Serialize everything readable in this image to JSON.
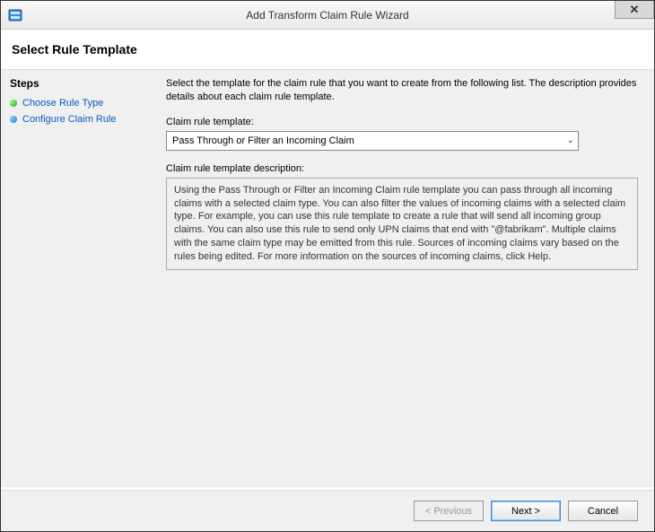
{
  "window": {
    "title": "Add Transform Claim Rule Wizard"
  },
  "header": {
    "subtitle": "Select Rule Template"
  },
  "sidebar": {
    "heading": "Steps",
    "items": [
      {
        "label": "Choose Rule Type"
      },
      {
        "label": "Configure Claim Rule"
      }
    ]
  },
  "content": {
    "intro": "Select the template for the claim rule that you want to create from the following list. The description provides details about each claim rule template.",
    "template_label": "Claim rule template:",
    "template_selected": "Pass Through or Filter an Incoming Claim",
    "description_label": "Claim rule template description:",
    "description_text": "Using the Pass Through or Filter an Incoming Claim rule template you can pass through all incoming claims with a selected claim type.  You can also filter the values of incoming claims with a selected claim type.  For example, you can use this rule template to create a rule that will send all incoming group claims.  You can also use this rule to send only UPN claims that end with \"@fabrikam\".  Multiple claims with the same claim type may be emitted from this rule.  Sources of incoming claims vary based on the rules being edited.  For more information on the sources of incoming claims, click Help."
  },
  "footer": {
    "previous": "< Previous",
    "next": "Next >",
    "cancel": "Cancel"
  }
}
